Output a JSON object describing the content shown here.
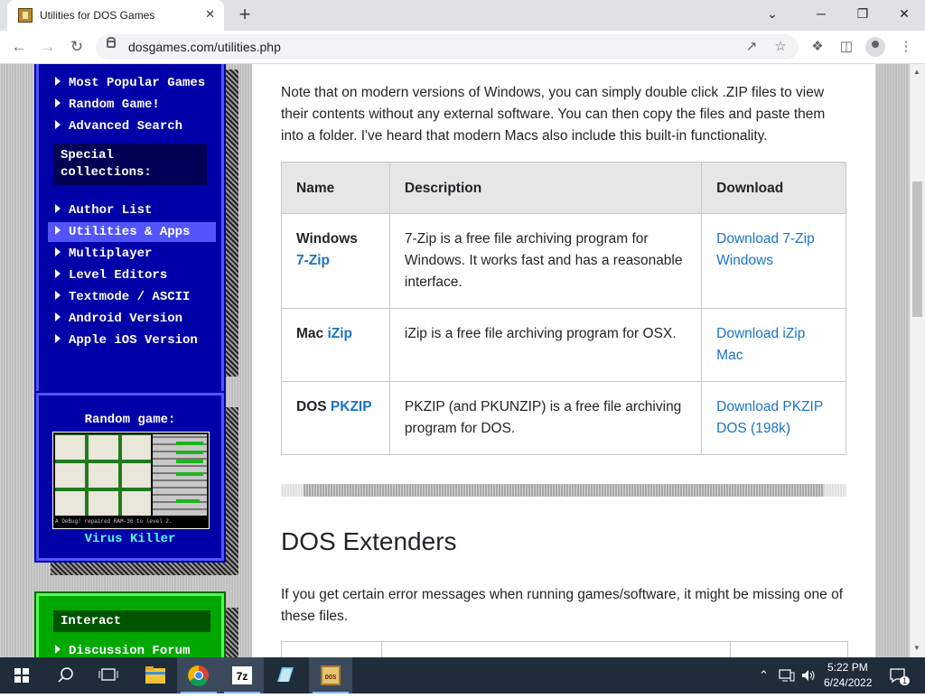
{
  "browser": {
    "tab_title": "Utilities for DOS Games",
    "tab_close": "✕",
    "new_tab": "+",
    "url": "dosgames.com/utilities.php",
    "window_controls": {
      "minimize": "⌄",
      "min": "─",
      "restore": "❐",
      "close": "✕"
    }
  },
  "sidebar": {
    "nav_items_top": [
      {
        "label": "Most Popular Games"
      },
      {
        "label": "Random Game!"
      },
      {
        "label": "Advanced Search"
      }
    ],
    "special_heading": "Special collections:",
    "nav_items": [
      {
        "label": "Author List",
        "active": false
      },
      {
        "label": "Utilities & Apps",
        "active": true
      },
      {
        "label": "Multiplayer",
        "active": false
      },
      {
        "label": "Level Editors",
        "active": false
      },
      {
        "label": "Textmode / ASCII",
        "active": false
      },
      {
        "label": "Android Version",
        "active": false
      },
      {
        "label": "Apple iOS Version",
        "active": false
      }
    ],
    "random_game": {
      "heading": "Random game:",
      "game_title": "Virus Killer",
      "screenshot_status": "A DeBug! repaired RAM-36 to level 2."
    },
    "interact": {
      "heading": "Interact",
      "items": [
        {
          "label": "Discussion Forum"
        }
      ]
    }
  },
  "content": {
    "intro": "Note that on modern versions of Windows, you can simply double click .ZIP files to view their contents without any external software. You can then copy the files and paste them into a folder. I've heard that modern Macs also include this built-in functionality.",
    "table": {
      "headers": [
        "Name",
        "Description",
        "Download"
      ],
      "rows": [
        {
          "platform": "Windows",
          "name_link": "7-Zip",
          "description": "7-Zip is a free file archiving program for Windows. It works fast and has a reasonable interface.",
          "download": "Download 7-Zip Windows"
        },
        {
          "platform": "Mac",
          "name_link": "iZip",
          "description": "iZip is a free file archiving program for OSX.",
          "download": "Download iZip Mac"
        },
        {
          "platform": "DOS",
          "name_link": "PKZIP",
          "description": "PKZIP (and PKUNZIP) is a free file archiving program for DOS.",
          "download": "Download PKZIP DOS (198k)"
        }
      ]
    },
    "section_heading": "DOS Extenders",
    "section_intro": "If you get certain error messages when running games/software, it might be missing one of these files."
  },
  "taskbar": {
    "apps": [
      "File Explorer",
      "Google Chrome",
      "7-Zip",
      "Notepad",
      "DOSGames"
    ],
    "time": "5:22 PM",
    "date": "6/24/2022",
    "notification_count": "1"
  },
  "colors": {
    "link": "#1a73c8",
    "dos_blue": "#0000a8",
    "dos_highlight": "#5454fc",
    "dos_green": "#00a800",
    "taskbar": "#1f2c3a"
  }
}
